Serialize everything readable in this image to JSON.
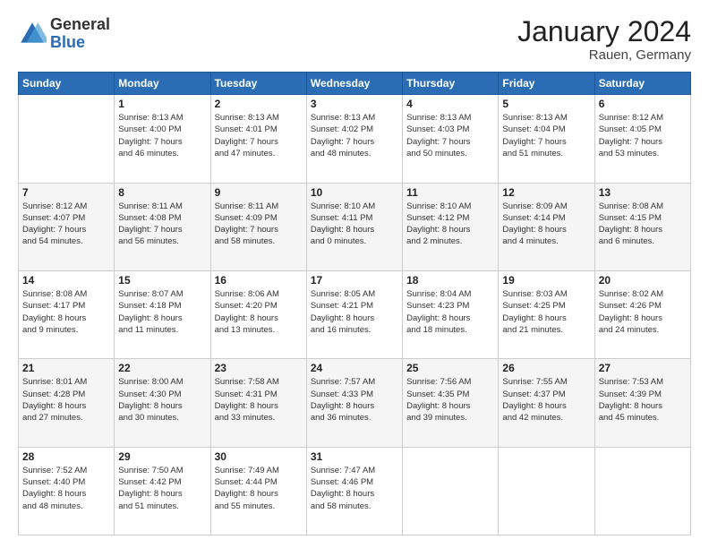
{
  "logo": {
    "general": "General",
    "blue": "Blue"
  },
  "header": {
    "month": "January 2024",
    "location": "Rauen, Germany"
  },
  "weekdays": [
    "Sunday",
    "Monday",
    "Tuesday",
    "Wednesday",
    "Thursday",
    "Friday",
    "Saturday"
  ],
  "weeks": [
    [
      {
        "day": "",
        "info": ""
      },
      {
        "day": "1",
        "info": "Sunrise: 8:13 AM\nSunset: 4:00 PM\nDaylight: 7 hours\nand 46 minutes."
      },
      {
        "day": "2",
        "info": "Sunrise: 8:13 AM\nSunset: 4:01 PM\nDaylight: 7 hours\nand 47 minutes."
      },
      {
        "day": "3",
        "info": "Sunrise: 8:13 AM\nSunset: 4:02 PM\nDaylight: 7 hours\nand 48 minutes."
      },
      {
        "day": "4",
        "info": "Sunrise: 8:13 AM\nSunset: 4:03 PM\nDaylight: 7 hours\nand 50 minutes."
      },
      {
        "day": "5",
        "info": "Sunrise: 8:13 AM\nSunset: 4:04 PM\nDaylight: 7 hours\nand 51 minutes."
      },
      {
        "day": "6",
        "info": "Sunrise: 8:12 AM\nSunset: 4:05 PM\nDaylight: 7 hours\nand 53 minutes."
      }
    ],
    [
      {
        "day": "7",
        "info": "Sunrise: 8:12 AM\nSunset: 4:07 PM\nDaylight: 7 hours\nand 54 minutes."
      },
      {
        "day": "8",
        "info": "Sunrise: 8:11 AM\nSunset: 4:08 PM\nDaylight: 7 hours\nand 56 minutes."
      },
      {
        "day": "9",
        "info": "Sunrise: 8:11 AM\nSunset: 4:09 PM\nDaylight: 7 hours\nand 58 minutes."
      },
      {
        "day": "10",
        "info": "Sunrise: 8:10 AM\nSunset: 4:11 PM\nDaylight: 8 hours\nand 0 minutes."
      },
      {
        "day": "11",
        "info": "Sunrise: 8:10 AM\nSunset: 4:12 PM\nDaylight: 8 hours\nand 2 minutes."
      },
      {
        "day": "12",
        "info": "Sunrise: 8:09 AM\nSunset: 4:14 PM\nDaylight: 8 hours\nand 4 minutes."
      },
      {
        "day": "13",
        "info": "Sunrise: 8:08 AM\nSunset: 4:15 PM\nDaylight: 8 hours\nand 6 minutes."
      }
    ],
    [
      {
        "day": "14",
        "info": "Sunrise: 8:08 AM\nSunset: 4:17 PM\nDaylight: 8 hours\nand 9 minutes."
      },
      {
        "day": "15",
        "info": "Sunrise: 8:07 AM\nSunset: 4:18 PM\nDaylight: 8 hours\nand 11 minutes."
      },
      {
        "day": "16",
        "info": "Sunrise: 8:06 AM\nSunset: 4:20 PM\nDaylight: 8 hours\nand 13 minutes."
      },
      {
        "day": "17",
        "info": "Sunrise: 8:05 AM\nSunset: 4:21 PM\nDaylight: 8 hours\nand 16 minutes."
      },
      {
        "day": "18",
        "info": "Sunrise: 8:04 AM\nSunset: 4:23 PM\nDaylight: 8 hours\nand 18 minutes."
      },
      {
        "day": "19",
        "info": "Sunrise: 8:03 AM\nSunset: 4:25 PM\nDaylight: 8 hours\nand 21 minutes."
      },
      {
        "day": "20",
        "info": "Sunrise: 8:02 AM\nSunset: 4:26 PM\nDaylight: 8 hours\nand 24 minutes."
      }
    ],
    [
      {
        "day": "21",
        "info": "Sunrise: 8:01 AM\nSunset: 4:28 PM\nDaylight: 8 hours\nand 27 minutes."
      },
      {
        "day": "22",
        "info": "Sunrise: 8:00 AM\nSunset: 4:30 PM\nDaylight: 8 hours\nand 30 minutes."
      },
      {
        "day": "23",
        "info": "Sunrise: 7:58 AM\nSunset: 4:31 PM\nDaylight: 8 hours\nand 33 minutes."
      },
      {
        "day": "24",
        "info": "Sunrise: 7:57 AM\nSunset: 4:33 PM\nDaylight: 8 hours\nand 36 minutes."
      },
      {
        "day": "25",
        "info": "Sunrise: 7:56 AM\nSunset: 4:35 PM\nDaylight: 8 hours\nand 39 minutes."
      },
      {
        "day": "26",
        "info": "Sunrise: 7:55 AM\nSunset: 4:37 PM\nDaylight: 8 hours\nand 42 minutes."
      },
      {
        "day": "27",
        "info": "Sunrise: 7:53 AM\nSunset: 4:39 PM\nDaylight: 8 hours\nand 45 minutes."
      }
    ],
    [
      {
        "day": "28",
        "info": "Sunrise: 7:52 AM\nSunset: 4:40 PM\nDaylight: 8 hours\nand 48 minutes."
      },
      {
        "day": "29",
        "info": "Sunrise: 7:50 AM\nSunset: 4:42 PM\nDaylight: 8 hours\nand 51 minutes."
      },
      {
        "day": "30",
        "info": "Sunrise: 7:49 AM\nSunset: 4:44 PM\nDaylight: 8 hours\nand 55 minutes."
      },
      {
        "day": "31",
        "info": "Sunrise: 7:47 AM\nSunset: 4:46 PM\nDaylight: 8 hours\nand 58 minutes."
      },
      {
        "day": "",
        "info": ""
      },
      {
        "day": "",
        "info": ""
      },
      {
        "day": "",
        "info": ""
      }
    ]
  ]
}
